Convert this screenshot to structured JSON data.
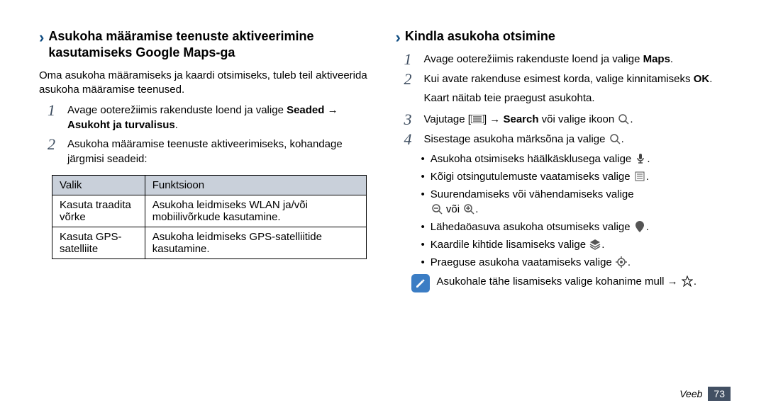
{
  "left": {
    "heading": "Asukoha määramise teenuste aktiveerimine kasutamiseks Google Maps-ga",
    "intro": "Oma asukoha määramiseks ja kaardi otsimiseks, tuleb teil aktiveerida asukoha määramise teenused.",
    "step1_prefix": "Avage ooterežiimis rakenduste loend ja valige ",
    "step1_bold1": "Seaded",
    "step1_arrow": " → ",
    "step1_bold2": "Asukoht ja turvalisus",
    "step1_suffix": ".",
    "step2": "Asukoha määramise teenuste aktiveerimiseks, kohandage järgmisi seadeid:",
    "table": {
      "header": {
        "col1": "Valik",
        "col2": "Funktsioon"
      },
      "rows": [
        {
          "col1": "Kasuta traadita võrke",
          "col2": "Asukoha leidmiseks WLAN ja/või mobiilivõrkude kasutamine."
        },
        {
          "col1": "Kasuta GPS-satelliite",
          "col2": "Asukoha leidmiseks GPS-satelliitide kasutamine."
        }
      ]
    }
  },
  "right": {
    "heading": "Kindla asukoha otsimine",
    "step1_prefix": "Avage ooterežiimis rakenduste loend ja valige ",
    "step1_bold": "Maps",
    "step1_suffix": ".",
    "step2_prefix": "Kui avate rakenduse esimest korda, valige kinnitamiseks ",
    "step2_bold": "OK",
    "step2_suffix": ".",
    "step2_after": "Kaart näitab teie praegust asukohta.",
    "step3_prefix": "Vajutage [",
    "step3_mid": "] → ",
    "step3_bold": "Search",
    "step3_suffix": " või valige ikoon ",
    "step3_end": ".",
    "step4_prefix": "Sisestage asukoha märksõna ja valige ",
    "step4_suffix": ".",
    "bullets": {
      "b1_prefix": "Asukoha otsimiseks häälkäsklusega valige ",
      "b1_suffix": ".",
      "b2_prefix": "Kõigi otsingutulemuste vaatamiseks valige ",
      "b2_suffix": ".",
      "b3_prefix": "Suurendamiseks või vähendamiseks valige ",
      "b3_mid": " või ",
      "b3_suffix": ".",
      "b4_prefix": "Lähedaöasuva asukoha otsumiseks valige ",
      "b4_suffix": ".",
      "b5_prefix": "Kaardile kihtide lisamiseks valige ",
      "b5_suffix": ".",
      "b6_prefix": "Praeguse asukoha vaatamiseks valige ",
      "b6_suffix": "."
    },
    "note_prefix": "Asukohale tähe lisamiseks valige kohanime mull → ",
    "note_suffix": "."
  },
  "footer": {
    "label": "Veeb",
    "page": "73"
  },
  "icons": {
    "menu_key": "menu-key-icon",
    "search": "search-icon",
    "search_small": "search-icon",
    "mic": "mic-icon",
    "list": "list-icon",
    "zoom_out": "zoom-out-icon",
    "zoom_in": "zoom-in-icon",
    "place": "place-marker-icon",
    "layers": "layers-icon",
    "my_location": "my-location-icon",
    "star": "star-icon",
    "note": "note-icon"
  }
}
